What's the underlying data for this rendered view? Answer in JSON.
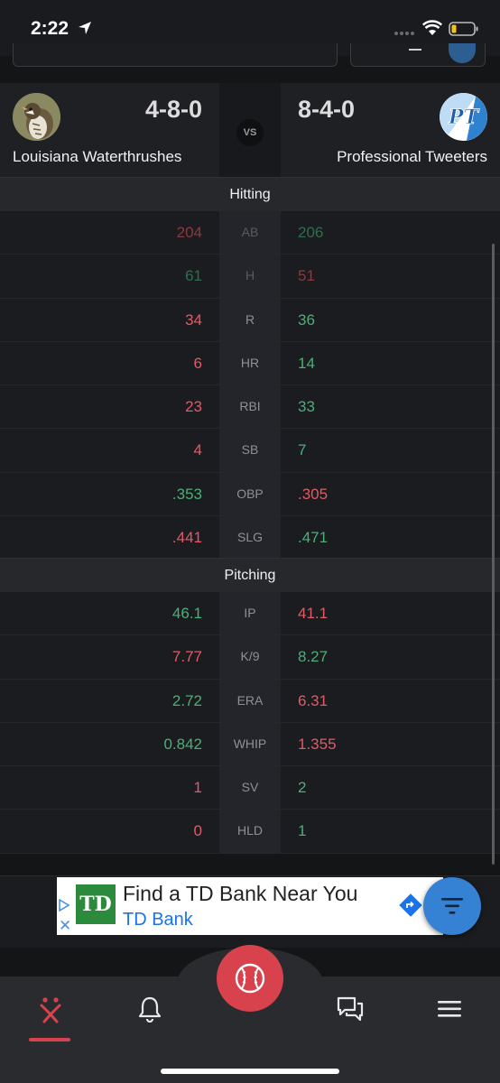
{
  "status_bar": {
    "time": "2:22",
    "icons": [
      "location-arrow-icon",
      "signal-icon",
      "wifi-icon",
      "battery-icon"
    ]
  },
  "matchup": {
    "left_team": {
      "name": "Louisiana Waterthrushes",
      "record": "4-8-0",
      "avatar": "bird-photo-avatar"
    },
    "right_team": {
      "name": "Professional Tweeters",
      "record": "8-4-0",
      "avatar": "pt-logo-avatar",
      "logo_text": "PT"
    },
    "vs_label": "VS"
  },
  "sections": {
    "hitting": "Hitting",
    "pitching": "Pitching"
  },
  "hitting_rows": [
    {
      "cat": "AB",
      "left": "204",
      "right": "206",
      "left_color": "red",
      "right_color": "green",
      "dim": true
    },
    {
      "cat": "H",
      "left": "61",
      "right": "51",
      "left_color": "green",
      "right_color": "red",
      "dim": true
    },
    {
      "cat": "R",
      "left": "34",
      "right": "36",
      "left_color": "red",
      "right_color": "green",
      "dim": false
    },
    {
      "cat": "HR",
      "left": "6",
      "right": "14",
      "left_color": "red",
      "right_color": "green",
      "dim": false
    },
    {
      "cat": "RBI",
      "left": "23",
      "right": "33",
      "left_color": "red",
      "right_color": "green",
      "dim": false
    },
    {
      "cat": "SB",
      "left": "4",
      "right": "7",
      "left_color": "red",
      "right_color": "green",
      "dim": false
    },
    {
      "cat": "OBP",
      "left": ".353",
      "right": ".305",
      "left_color": "green",
      "right_color": "red",
      "dim": false
    },
    {
      "cat": "SLG",
      "left": ".441",
      "right": ".471",
      "left_color": "red",
      "right_color": "green",
      "dim": false
    }
  ],
  "pitching_rows": [
    {
      "cat": "IP",
      "left": "46.1",
      "right": "41.1",
      "left_color": "green",
      "right_color": "red",
      "dim": false
    },
    {
      "cat": "K/9",
      "left": "7.77",
      "right": "8.27",
      "left_color": "red",
      "right_color": "green",
      "dim": false
    },
    {
      "cat": "ERA",
      "left": "2.72",
      "right": "6.31",
      "left_color": "green",
      "right_color": "red",
      "dim": false
    },
    {
      "cat": "WHIP",
      "left": "0.842",
      "right": "1.355",
      "left_color": "green",
      "right_color": "red",
      "dim": false
    },
    {
      "cat": "SV",
      "left": "1",
      "right": "2",
      "left_color": "red",
      "right_color": "green",
      "dim": false
    },
    {
      "cat": "HLD",
      "left": "0",
      "right": "1",
      "left_color": "red",
      "right_color": "green",
      "dim": false
    }
  ],
  "ad": {
    "title": "Find a TD Bank Near You",
    "advertiser": "TD Bank",
    "logo_text": "TD",
    "close_label": "✕"
  },
  "nav": {
    "items": [
      "matchup-icon",
      "bell-icon",
      "baseball-icon",
      "chat-icon",
      "menu-icon"
    ],
    "active": "matchup-icon"
  },
  "colors": {
    "win": "#4caf78",
    "loss": "#e35a67",
    "accent": "#d8424c",
    "fab": "#3582d4",
    "background": "#141517"
  }
}
